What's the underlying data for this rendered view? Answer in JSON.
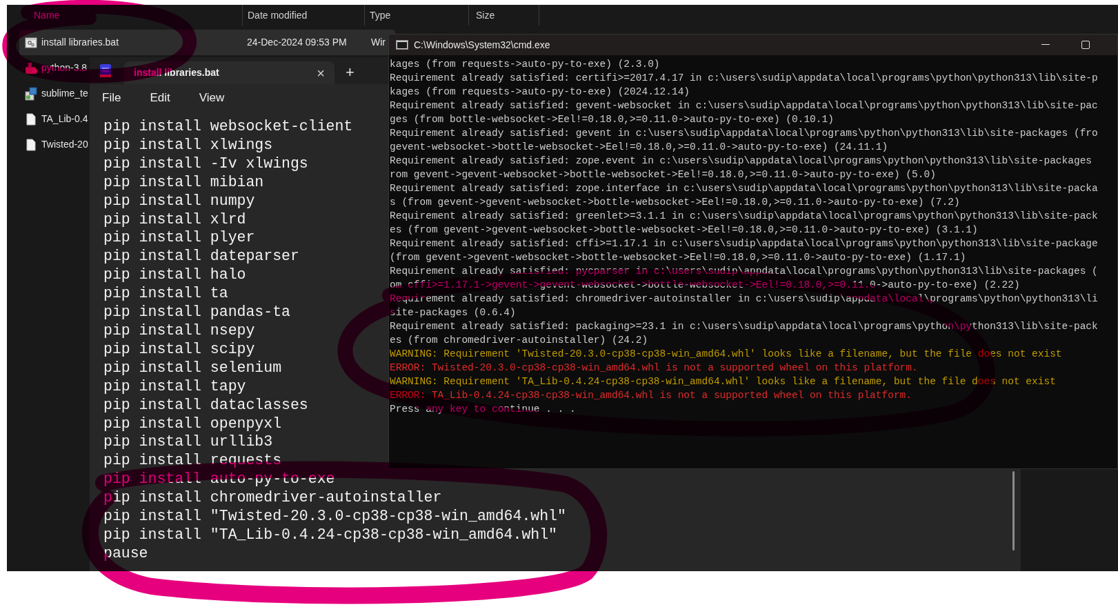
{
  "explorer": {
    "columns": [
      "Name",
      "Date modified",
      "Type",
      "Size"
    ],
    "files": [
      {
        "name": "install libraries.bat",
        "date": "24-Dec-2024 09:53 PM",
        "type": "Wir",
        "kind": "script",
        "selected": true
      },
      {
        "name": "python-3.8",
        "kind": "installer",
        "selected": false
      },
      {
        "name": "sublime_te",
        "kind": "package",
        "selected": false
      },
      {
        "name": "TA_Lib-0.4",
        "kind": "document",
        "selected": false
      },
      {
        "name": "Twisted-20",
        "kind": "document",
        "selected": false
      }
    ]
  },
  "notepad": {
    "tab": "install libraries.bat",
    "close": "×",
    "add": "+",
    "menu": [
      "File",
      "Edit",
      "View"
    ],
    "lines": [
      "pip install websocket-client",
      "pip install xlwings",
      "pip install -Iv xlwings",
      "pip install mibian",
      "pip install numpy",
      "pip install xlrd",
      "pip install plyer",
      "pip install dateparser",
      "pip install halo",
      "pip install ta",
      "pip install pandas-ta",
      "pip install nsepy",
      "pip install scipy",
      "pip install selenium",
      "pip install tapy",
      "pip install dataclasses",
      "pip install openpyxl",
      "pip install urllib3",
      "pip install requests",
      "pip install auto-py-to-exe",
      "pip install chromedriver-autoinstaller",
      "pip install \"Twisted-20.3.0-cp38-cp38-win_amd64.whl\"",
      "pip install \"TA_Lib-0.4.24-cp38-cp38-win_amd64.whl\"",
      "pause"
    ]
  },
  "cmd": {
    "title": "C:\\Windows\\System32\\cmd.exe",
    "lines": [
      {
        "kind": "normal",
        "text": "kages (from requests->auto-py-to-exe) (2.3.0)"
      },
      {
        "kind": "normal",
        "text": "Requirement already satisfied: certifi>=2017.4.17 in c:\\users\\sudip\\appdata\\local\\programs\\python\\python313\\lib\\site-p"
      },
      {
        "kind": "normal",
        "text": "kages (from requests->auto-py-to-exe) (2024.12.14)"
      },
      {
        "kind": "normal",
        "text": "Requirement already satisfied: gevent-websocket in c:\\users\\sudip\\appdata\\local\\programs\\python\\python313\\lib\\site-pac"
      },
      {
        "kind": "normal",
        "text": "ges (from bottle-websocket->Eel!=0.18.0,>=0.11.0->auto-py-to-exe) (0.10.1)"
      },
      {
        "kind": "normal",
        "text": "Requirement already satisfied: gevent in c:\\users\\sudip\\appdata\\local\\programs\\python\\python313\\lib\\site-packages (fro"
      },
      {
        "kind": "normal",
        "text": "gevent-websocket->bottle-websocket->Eel!=0.18.0,>=0.11.0->auto-py-to-exe) (24.11.1)"
      },
      {
        "kind": "normal",
        "text": "Requirement already satisfied: zope.event in c:\\users\\sudip\\appdata\\local\\programs\\python\\python313\\lib\\site-packages"
      },
      {
        "kind": "normal",
        "text": "rom gevent->gevent-websocket->bottle-websocket->Eel!=0.18.0,>=0.11.0->auto-py-to-exe) (5.0)"
      },
      {
        "kind": "normal",
        "text": "Requirement already satisfied: zope.interface in c:\\users\\sudip\\appdata\\local\\programs\\python\\python313\\lib\\site-packa"
      },
      {
        "kind": "normal",
        "text": "s (from gevent->gevent-websocket->bottle-websocket->Eel!=0.18.0,>=0.11.0->auto-py-to-exe) (7.2)"
      },
      {
        "kind": "normal",
        "text": "Requirement already satisfied: greenlet>=3.1.1 in c:\\users\\sudip\\appdata\\local\\programs\\python\\python313\\lib\\site-pack"
      },
      {
        "kind": "normal",
        "text": "es (from gevent->gevent-websocket->bottle-websocket->Eel!=0.18.0,>=0.11.0->auto-py-to-exe) (3.1.1)"
      },
      {
        "kind": "normal",
        "text": "Requirement already satisfied: cffi>=1.17.1 in c:\\users\\sudip\\appdata\\local\\programs\\python\\python313\\lib\\site-package"
      },
      {
        "kind": "normal",
        "text": "(from gevent->gevent-websocket->bottle-websocket->Eel!=0.18.0,>=0.11.0->auto-py-to-exe) (1.17.1)"
      },
      {
        "kind": "normal",
        "text": "Requirement already satisfied: pycparser in c:\\users\\sudip\\appdata\\local\\programs\\python\\python313\\lib\\site-packages ("
      },
      {
        "kind": "normal",
        "text": "om cffi>=1.17.1->gevent->gevent-websocket->bottle-websocket->Eel!=0.18.0,>=0.11.0->auto-py-to-exe) (2.22)"
      },
      {
        "kind": "normal",
        "text": "Requirement already satisfied: chromedriver-autoinstaller in c:\\users\\sudip\\appdata\\local\\programs\\python\\python313\\li"
      },
      {
        "kind": "normal",
        "text": "site-packages (0.6.4)"
      },
      {
        "kind": "normal",
        "text": "Requirement already satisfied: packaging>=23.1 in c:\\users\\sudip\\appdata\\local\\programs\\python\\python313\\lib\\site-pack"
      },
      {
        "kind": "normal",
        "text": "es (from chromedriver-autoinstaller) (24.2)"
      },
      {
        "kind": "warning",
        "text": "WARNING: Requirement 'Twisted-20.3.0-cp38-cp38-win_amd64.whl' looks like a filename, but the file does not exist"
      },
      {
        "kind": "error",
        "text": "ERROR: Twisted-20.3.0-cp38-cp38-win_amd64.whl is not a supported wheel on this platform."
      },
      {
        "kind": "warning",
        "text": "WARNING: Requirement 'TA_Lib-0.4.24-cp38-cp38-win_amd64.whl' looks like a filename, but the file does not exist"
      },
      {
        "kind": "error",
        "text": "ERROR: TA_Lib-0.4.24-cp38-cp38-win_amd64.whl is not a supported wheel on this platform."
      },
      {
        "kind": "normal",
        "text": "Press any key to continue . . ."
      }
    ]
  }
}
